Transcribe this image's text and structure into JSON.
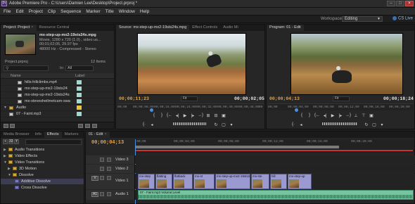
{
  "window": {
    "title": "Adobe Premiere Pro - C:\\Users\\Damien Lee\\Desktop\\Project.prproj *",
    "app_icon": "Pr"
  },
  "menu": [
    "File",
    "Edit",
    "Project",
    "Clip",
    "Sequence",
    "Marker",
    "Title",
    "Window",
    "Help"
  ],
  "workspace": {
    "label": "Workspace:",
    "value": "Editing",
    "cs_live": "CS Live"
  },
  "project_panel": {
    "tabs": [
      "Project: Project",
      "Resource Central"
    ],
    "clip": {
      "name": "mx-step-up-mx2-19sts24s.mpg",
      "type": "Movie, 1280 x 720 (1.0) , video us...",
      "duration": "00;01;02;05, 29.97 fps",
      "audio": "48000 Hz - Compressed - Stereo"
    },
    "file": "Project.prproj",
    "item_count": "12 Items",
    "in_label": "In:",
    "in_value": "All",
    "col_name": "Name",
    "col_label": "Label",
    "rows": [
      {
        "name": "hills-hillclimbs.mp4",
        "label_color": "#9fd9d0"
      },
      {
        "name": "mx-step-up-mx2-19sts24",
        "label_color": "#9fd9d0"
      },
      {
        "name": "mx-step-up-mx2-19sts24s",
        "label_color": "#9fd9d0"
      },
      {
        "name": "mx-stevesheilmetcam-swa",
        "label_color": "#9fd9d0"
      },
      {
        "name": "Audio",
        "label_color": "#e8c43a",
        "folder": true
      },
      {
        "name": "07 - Faint.mp3",
        "label_color": "#9fd9d0"
      }
    ]
  },
  "source_monitor": {
    "tabs": [
      "Source: mx-step-up-mx2-19sts24s.mpg",
      "Effect Controls",
      "Audio Mi"
    ],
    "timecode_in": "00;00;11;23",
    "timecode_dur": "00;00;02;05",
    "fit": "Fit",
    "ruler": [
      "00;00",
      "00;00;08;00",
      "00;00;16;00",
      "00;00;24;00",
      "00;00;32;00",
      "00;00;40;00",
      "00;00;48;00",
      "00"
    ]
  },
  "program_monitor": {
    "tabs": [
      "Program: 01 - Edit"
    ],
    "timecode_in": "00;00;04;13",
    "timecode_dur": "00;00;18;24",
    "fit": "Fit",
    "ruler": [
      "00;00",
      "00;00;04;00",
      "00;00;08;00",
      "00;00;12;00",
      "00;00;16;00",
      "00;00;20;00"
    ]
  },
  "effects_panel": {
    "tabs": [
      "Media Browser",
      "Info",
      "Effects",
      "Markers"
    ],
    "rows": [
      {
        "name": "Audio Transitions",
        "folder": true,
        "indent": 0
      },
      {
        "name": "Video Effects",
        "folder": true,
        "indent": 0
      },
      {
        "name": "Video Transitions",
        "folder": true,
        "indent": 0
      },
      {
        "name": "3D Motion",
        "folder": true,
        "indent": 1
      },
      {
        "name": "Dissolve",
        "folder": true,
        "indent": 1
      },
      {
        "name": "Additive Dissolve",
        "folder": false,
        "indent": 2,
        "selected": true
      },
      {
        "name": "Cross Dissolve",
        "folder": false,
        "indent": 2
      }
    ]
  },
  "timeline": {
    "tabs": [
      "01 - Edit"
    ],
    "timecode": "00;00;04;13",
    "ruler": [
      "00;00",
      "00;00;04;00",
      "00;00;08;00",
      "00;00;12;00",
      "00;00;16;00",
      "00;00;20;00"
    ],
    "tracks": [
      {
        "name": "Video 3",
        "type": "video"
      },
      {
        "name": "Video 2",
        "type": "video"
      },
      {
        "name": "Video 1",
        "type": "video1",
        "target": "V"
      },
      {
        "name": "Audio 1",
        "type": "audio1",
        "target": "A1"
      }
    ],
    "video_clips": [
      "mx-step",
      "flatting",
      "flatback",
      "mx-st",
      "mx-step-up-mx2-19sts24",
      "mx-ste",
      "hill",
      "mx-step-up"
    ],
    "audio_clip": "07 - Faint.mp3  Volume:Level"
  }
}
